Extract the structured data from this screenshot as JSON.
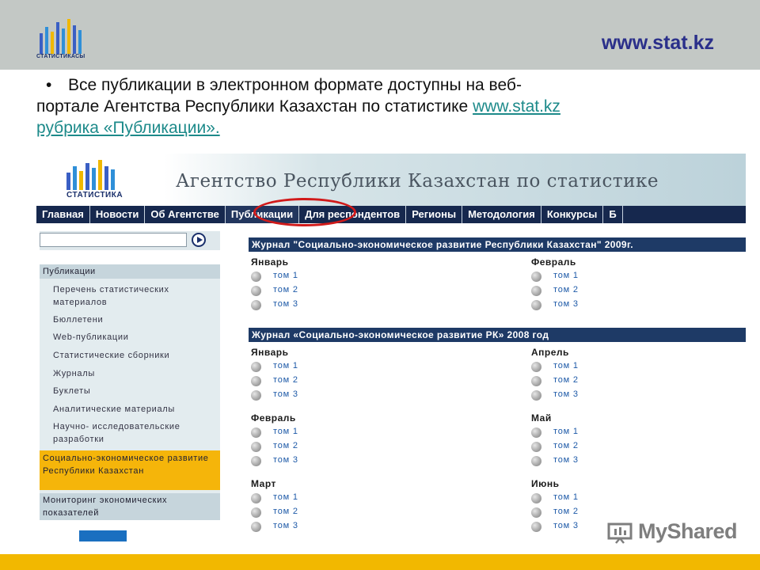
{
  "header": {
    "logo_text": "СТАТИСТИКАСЫ",
    "site_url": "www.stat.kz"
  },
  "intro": {
    "bullet": "•",
    "line1": "Все публикации в электронном формате доступны на веб-",
    "line2_prefix": "портале Агентства Республики Казахстан по статистике ",
    "link": "www.stat.kz",
    "line3": "рубрика «Публикации»."
  },
  "screenshot": {
    "logo_text": "СТАТИСТИКА",
    "agency_title": "Агентство Республики Казахстан по статистике",
    "nav": [
      "Главная",
      "Новости",
      "Об Агентстве",
      "Публикации",
      "Для респондентов",
      "Регионы",
      "Методология",
      "Конкурсы",
      "Б"
    ],
    "active_nav": "Публикации",
    "sidebar": {
      "head": "Публикации",
      "items": [
        "Перечень статистических материалов",
        "Бюллетени",
        "Web-публикации",
        "Статистические сборники",
        "Журналы",
        "Буклеты",
        "Аналитические материалы",
        "Научно- исследовательские разработки"
      ],
      "highlight": "Социально-экономическое развитие Республики Казахстан",
      "bottom": "Мониторинг экономических показателей"
    },
    "journal1": {
      "title": "Журнал \"Социально-экономическое развитие Республики Казахстан\" 2009г.",
      "left_month": "Январь",
      "right_month": "Февраль"
    },
    "journal2": {
      "title": "Журнал «Социально-экономическое развитие РК» 2008 год",
      "months": [
        "Январь",
        "Апрель",
        "Февраль",
        "Май",
        "Март",
        "Июнь"
      ]
    },
    "volumes": [
      "том 1",
      "том 2",
      "том 3"
    ]
  },
  "watermark": "MyShared",
  "colors": {
    "nav_bg": "#16284e",
    "journal_header": "#1e3a66",
    "highlight_yellow": "#f5b50a",
    "oval_red": "#d11a1a",
    "link_teal": "#1d8a8a",
    "url_blue": "#2a2f8a"
  }
}
